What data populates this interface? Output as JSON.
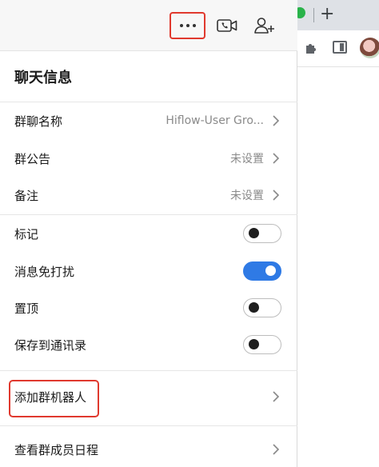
{
  "browser": {
    "new_tab_label": "+",
    "colors": {
      "tabbar": "#dee1e6",
      "status_dot": "#29b34a"
    }
  },
  "topbar": {
    "more_icon": "more-horizontal-icon",
    "video_icon": "video-call-icon",
    "add_member_icon": "add-user-icon",
    "highlight_color": "#e0392e"
  },
  "panel": {
    "title": "聊天信息",
    "group_name": {
      "label": "群聊名称",
      "value": "Hiflow-User Gro..."
    },
    "announcement": {
      "label": "群公告",
      "value": "未设置"
    },
    "remark": {
      "label": "备注",
      "value": "未设置"
    },
    "toggles": [
      {
        "label": "标记",
        "on": false
      },
      {
        "label": "消息免打扰",
        "on": true
      },
      {
        "label": "置顶",
        "on": false
      },
      {
        "label": "保存到通讯录",
        "on": false
      }
    ],
    "add_bot": {
      "label": "添加群机器人"
    },
    "member_schedule": {
      "label": "查看群成员日程"
    },
    "accent_color": "#2f7ae5"
  }
}
